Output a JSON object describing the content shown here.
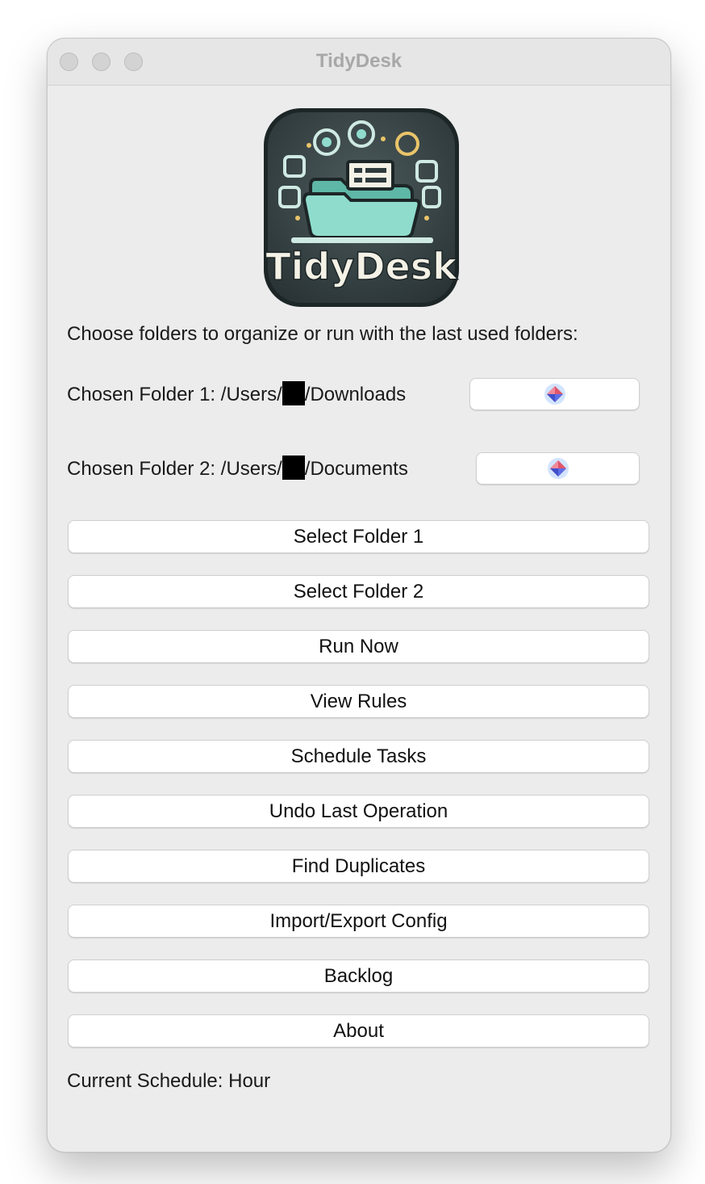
{
  "window": {
    "title": "TidyDesk"
  },
  "logo": {
    "text": "TidyDesk",
    "colors": {
      "tile": "#2f3b3d",
      "accent": "#8fdccd",
      "highlight": "#e9c46a"
    }
  },
  "prompt": "Choose folders to organize or run with the last used folders:",
  "folders": [
    {
      "label_prefix": "Chosen Folder 1: /Users/",
      "label_suffix": "/Downloads",
      "button_icon": "gem-icon"
    },
    {
      "label_prefix": "Chosen Folder 2: /Users/",
      "label_suffix": "/Documents",
      "button_icon": "gem-icon"
    }
  ],
  "buttons": [
    "Select Folder 1",
    "Select Folder 2",
    "Run Now",
    "View Rules",
    "Schedule Tasks",
    "Undo Last Operation",
    "Find Duplicates",
    "Import/Export Config",
    "Backlog",
    "About"
  ],
  "status": "Current Schedule: Hour"
}
